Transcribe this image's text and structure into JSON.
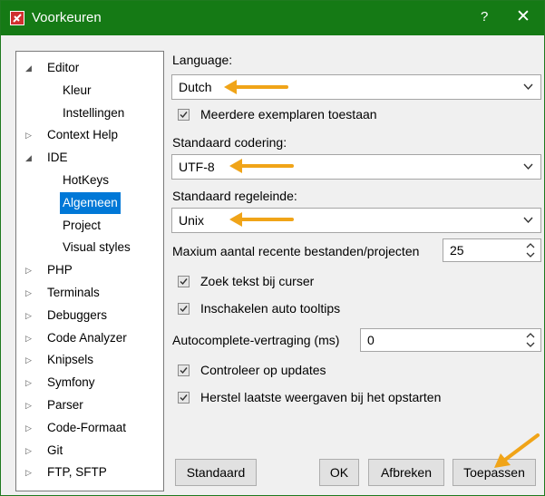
{
  "window": {
    "title": "Voorkeuren",
    "help_label": "?",
    "close_label": "✕",
    "accent_color": "#157a15"
  },
  "tree": {
    "items": [
      {
        "label": "Editor",
        "expander": "◢"
      },
      {
        "label": "Kleur"
      },
      {
        "label": "Instellingen"
      },
      {
        "label": "Context Help",
        "expander": "▷"
      },
      {
        "label": "IDE",
        "expander": "◢"
      },
      {
        "label": "HotKeys"
      },
      {
        "label": "Algemeen",
        "selected": true
      },
      {
        "label": "Project"
      },
      {
        "label": "Visual styles"
      },
      {
        "label": "PHP",
        "expander": "▷"
      },
      {
        "label": "Terminals",
        "expander": "▷"
      },
      {
        "label": "Debuggers",
        "expander": "▷"
      },
      {
        "label": "Code Analyzer",
        "expander": "▷"
      },
      {
        "label": "Knipsels",
        "expander": "▷"
      },
      {
        "label": "Symfony",
        "expander": "▷"
      },
      {
        "label": "Parser",
        "expander": "▷"
      },
      {
        "label": "Code-Formaat",
        "expander": "▷"
      },
      {
        "label": "Git",
        "expander": "▷"
      },
      {
        "label": "FTP, SFTP",
        "expander": "▷"
      }
    ]
  },
  "settings": {
    "language_label": "Language:",
    "language_value": "Dutch",
    "multiple_instances_label": "Meerdere exemplaren toestaan",
    "multiple_instances_checked": true,
    "encoding_label": "Standaard codering:",
    "encoding_value": "UTF-8",
    "line_ending_label": "Standaard regeleinde:",
    "line_ending_value": "Unix",
    "max_recent_label": "Maxium aantal recente bestanden/projecten",
    "max_recent_value": "25",
    "search_text_label": "Zoek tekst bij curser",
    "search_text_checked": true,
    "auto_tooltips_label": "Inschakelen auto tooltips",
    "auto_tooltips_checked": true,
    "autocomplete_delay_label": "Autocomplete-vertraging (ms)",
    "autocomplete_delay_value": "0",
    "check_updates_label": "Controleer op updates",
    "check_updates_checked": true,
    "restore_views_label": "Herstel laatste weergaven bij het opstarten",
    "restore_views_checked": true
  },
  "buttons": {
    "default_label": "Standaard",
    "ok_label": "OK",
    "cancel_label": "Afbreken",
    "apply_label": "Toepassen"
  },
  "annotation_color": "#f0a418"
}
